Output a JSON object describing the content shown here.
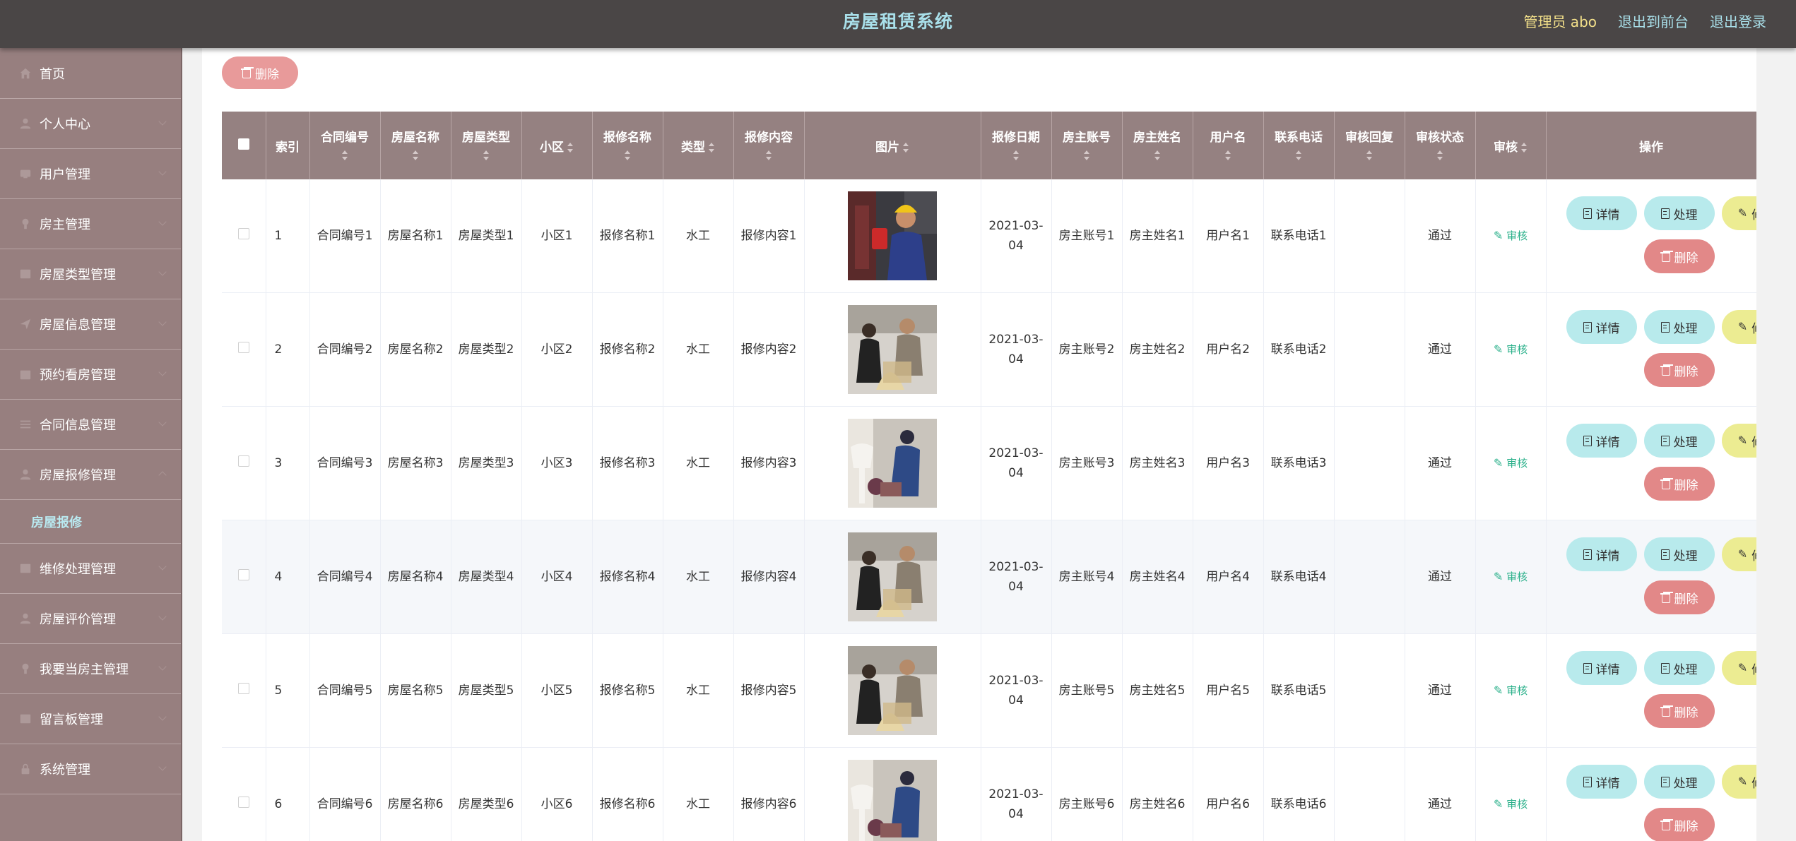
{
  "header": {
    "title": "房屋租赁系统",
    "admin": "管理员 abo",
    "to_front": "退出到前台",
    "logout": "退出登录"
  },
  "sidebar": {
    "items": [
      {
        "label": "首页",
        "icon": "home-icon"
      },
      {
        "label": "个人中心",
        "icon": "user-icon"
      },
      {
        "label": "用户管理",
        "icon": "users-icon"
      },
      {
        "label": "房主管理",
        "icon": "landlord-icon"
      },
      {
        "label": "房屋类型管理",
        "icon": "grid-icon"
      },
      {
        "label": "房屋信息管理",
        "icon": "send-icon"
      },
      {
        "label": "预约看房管理",
        "icon": "calendar-icon"
      },
      {
        "label": "合同信息管理",
        "icon": "list-icon"
      },
      {
        "label": "房屋报修管理",
        "icon": "user-icon"
      },
      {
        "label": "维修处理管理",
        "icon": "grid-icon"
      },
      {
        "label": "房屋评价管理",
        "icon": "user-icon"
      },
      {
        "label": "我要当房主管理",
        "icon": "landlord-icon"
      },
      {
        "label": "留言板管理",
        "icon": "grid-icon"
      },
      {
        "label": "系统管理",
        "icon": "lock-icon"
      }
    ],
    "submenu": "房屋报修"
  },
  "toolbar": {
    "delete_label": "删除"
  },
  "table": {
    "columns": [
      "索引",
      "合同编号",
      "房屋名称",
      "房屋类型",
      "小区",
      "报修名称",
      "类型",
      "报修内容",
      "图片",
      "报修日期",
      "房主账号",
      "房主姓名",
      "用户名",
      "联系电话",
      "审核回复",
      "审核状态",
      "审核",
      "操作"
    ],
    "rows": [
      {
        "idx": "1",
        "contract": "合同编号1",
        "house": "房屋名称1",
        "htype": "房屋类型1",
        "area": "小区1",
        "rname": "报修名称1",
        "type": "水工",
        "content": "报修内容1",
        "date": "2021-03-04",
        "owner_acc": "房主账号1",
        "owner_name": "房主姓名1",
        "user": "用户名1",
        "phone": "联系电话1",
        "reply": "",
        "status": "通过"
      },
      {
        "idx": "2",
        "contract": "合同编号2",
        "house": "房屋名称2",
        "htype": "房屋类型2",
        "area": "小区2",
        "rname": "报修名称2",
        "type": "水工",
        "content": "报修内容2",
        "date": "2021-03-04",
        "owner_acc": "房主账号2",
        "owner_name": "房主姓名2",
        "user": "用户名2",
        "phone": "联系电话2",
        "reply": "",
        "status": "通过"
      },
      {
        "idx": "3",
        "contract": "合同编号3",
        "house": "房屋名称3",
        "htype": "房屋类型3",
        "area": "小区3",
        "rname": "报修名称3",
        "type": "水工",
        "content": "报修内容3",
        "date": "2021-03-04",
        "owner_acc": "房主账号3",
        "owner_name": "房主姓名3",
        "user": "用户名3",
        "phone": "联系电话3",
        "reply": "",
        "status": "通过"
      },
      {
        "idx": "4",
        "contract": "合同编号4",
        "house": "房屋名称4",
        "htype": "房屋类型4",
        "area": "小区4",
        "rname": "报修名称4",
        "type": "水工",
        "content": "报修内容4",
        "date": "2021-03-04",
        "owner_acc": "房主账号4",
        "owner_name": "房主姓名4",
        "user": "用户名4",
        "phone": "联系电话4",
        "reply": "",
        "status": "通过"
      },
      {
        "idx": "5",
        "contract": "合同编号5",
        "house": "房屋名称5",
        "htype": "房屋类型5",
        "area": "小区5",
        "rname": "报修名称5",
        "type": "水工",
        "content": "报修内容5",
        "date": "2021-03-04",
        "owner_acc": "房主账号5",
        "owner_name": "房主姓名5",
        "user": "用户名5",
        "phone": "联系电话5",
        "reply": "",
        "status": "通过"
      },
      {
        "idx": "6",
        "contract": "合同编号6",
        "house": "房屋名称6",
        "htype": "房屋类型6",
        "area": "小区6",
        "rname": "报修名称6",
        "type": "水工",
        "content": "报修内容6",
        "date": "2021-03-04",
        "owner_acc": "房主账号6",
        "owner_name": "房主姓名6",
        "user": "用户名6",
        "phone": "联系电话6",
        "reply": "",
        "status": "通过"
      }
    ],
    "audit_label": "审核",
    "actions": {
      "detail": "详情",
      "handle": "处理",
      "edit": "修改",
      "delete": "删除"
    }
  },
  "colors": {
    "topbar": "#4a4646",
    "sidebar": "#977f7f",
    "table_header": "#958181",
    "accent_cyan": "#a9e0ea",
    "audit_green": "#2ab08a",
    "danger": "#e28888"
  }
}
